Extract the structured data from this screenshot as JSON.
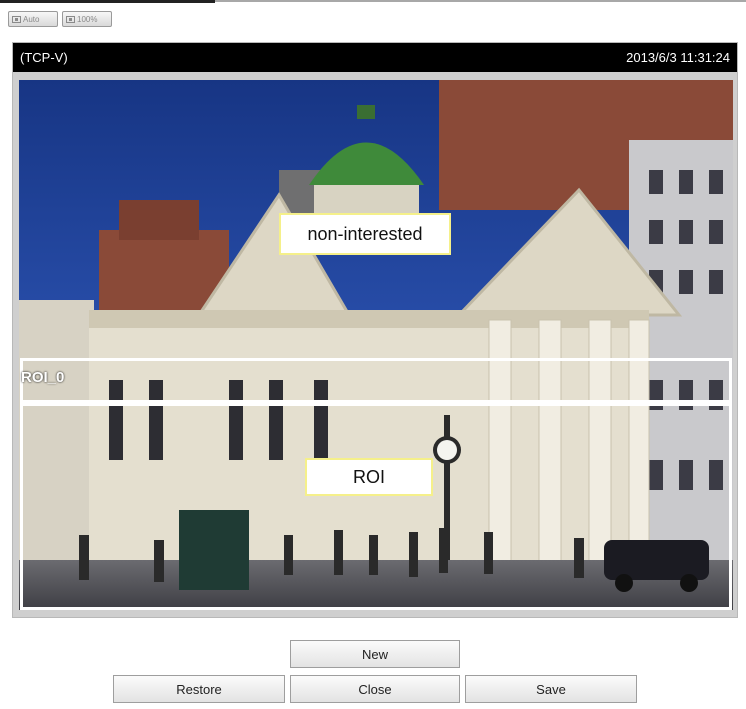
{
  "toolbar": {
    "auto_label": "Auto",
    "full_label": "100%"
  },
  "video": {
    "stream_label": "(TCP-V)",
    "timestamp": "2013/6/3 11:31:24"
  },
  "rois": {
    "region_name": "ROI_0",
    "non_interested_label": "non-interested",
    "interest_label": "ROI"
  },
  "buttons": {
    "new": "New",
    "restore": "Restore",
    "close": "Close",
    "save": "Save"
  },
  "colors": {
    "sky": "#1f3c8f",
    "building": "#e4dfcf",
    "dome": "#3f8a3a",
    "brick": "#8a4a38",
    "street": "#5a5a5e",
    "label_border": "#f5f08a"
  },
  "icons": {
    "auto": "fit-window-icon",
    "full": "actual-size-icon"
  }
}
